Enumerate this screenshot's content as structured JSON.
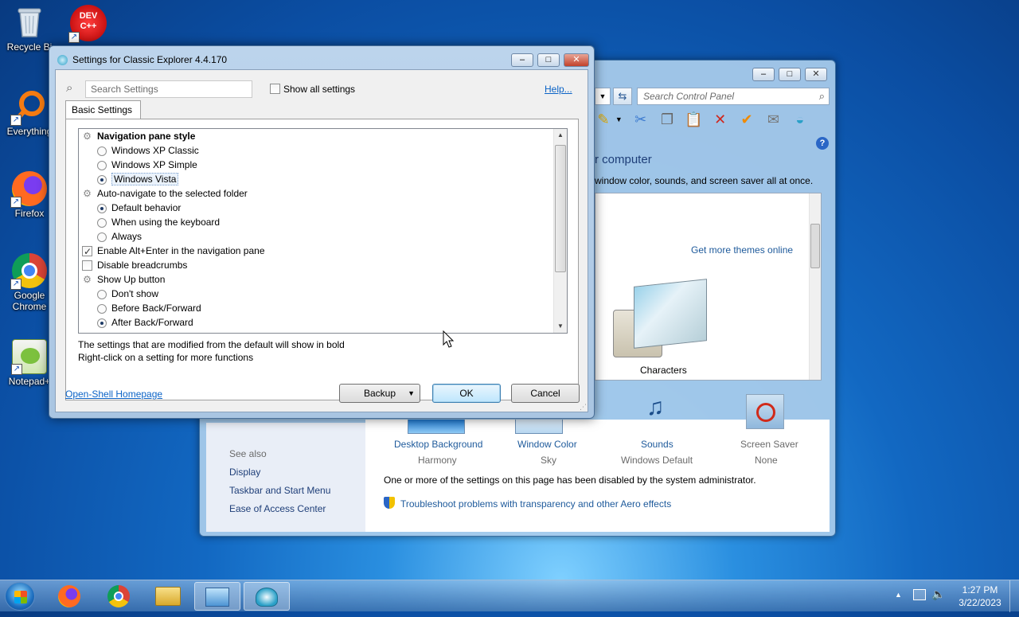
{
  "desktop": {
    "icons": [
      {
        "label": "Recycle Bi",
        "icon": "recycle-bin-icon"
      },
      {
        "label": "Everything",
        "icon": "everything-icon"
      },
      {
        "label": "Firefox",
        "icon": "firefox-icon"
      },
      {
        "label": "Google Chrome",
        "icon": "chrome-icon"
      },
      {
        "label": "Notepad+",
        "icon": "notepadpp-icon"
      }
    ],
    "devcpp_label": "DEV C++"
  },
  "control_panel": {
    "search_placeholder": "Search Control Panel",
    "heading_fragment": "r computer",
    "desc_fragment": "window color, sounds, and screen saver all at once.",
    "get_more_themes": "Get more themes online",
    "theme_name": "Characters",
    "items": [
      {
        "label": "Desktop Background",
        "sub": "Harmony"
      },
      {
        "label": "Window Color",
        "sub": "Sky"
      },
      {
        "label": "Sounds",
        "sub": "Windows Default"
      },
      {
        "label": "Screen Saver",
        "sub": "None"
      }
    ],
    "disabled_note": "One or more of the settings on this page has been disabled by the system administrator.",
    "troubleshoot_link": "Troubleshoot problems with transparency and other Aero effects",
    "see_also": {
      "title": "See also",
      "links": [
        "Display",
        "Taskbar and Start Menu",
        "Ease of Access Center"
      ]
    }
  },
  "dialog": {
    "title": "Settings for Classic Explorer 4.4.170",
    "search_placeholder": "Search Settings",
    "show_all_label": "Show all settings",
    "help_link": "Help...",
    "tab_label": "Basic Settings",
    "rows": [
      {
        "kind": "group",
        "label": "Navigation pane style",
        "bold": true
      },
      {
        "kind": "radio",
        "label": "Windows XP Classic",
        "checked": false
      },
      {
        "kind": "radio",
        "label": "Windows XP Simple",
        "checked": false
      },
      {
        "kind": "radio",
        "label": "Windows Vista",
        "checked": true,
        "selected": true
      },
      {
        "kind": "group",
        "label": "Auto-navigate to the selected folder"
      },
      {
        "kind": "radio",
        "label": "Default behavior",
        "checked": true
      },
      {
        "kind": "radio",
        "label": "When using the keyboard",
        "checked": false
      },
      {
        "kind": "radio",
        "label": "Always",
        "checked": false
      },
      {
        "kind": "check",
        "label": "Enable Alt+Enter in the navigation pane",
        "checked": true
      },
      {
        "kind": "check",
        "label": "Disable breadcrumbs",
        "checked": false
      },
      {
        "kind": "group",
        "label": "Show Up button"
      },
      {
        "kind": "radio",
        "label": "Don't show",
        "checked": false
      },
      {
        "kind": "radio",
        "label": "Before Back/Forward",
        "checked": false
      },
      {
        "kind": "radio",
        "label": "After Back/Forward",
        "checked": true
      }
    ],
    "note_line1": "The settings that are modified from the default will show in bold",
    "note_line2": "Right-click on a setting for more functions",
    "homepage_link": "Open-Shell Homepage",
    "backup_label": "Backup",
    "ok_label": "OK",
    "cancel_label": "Cancel"
  },
  "taskbar": {
    "clock_time": "1:27 PM",
    "clock_date": "3/22/2023"
  }
}
